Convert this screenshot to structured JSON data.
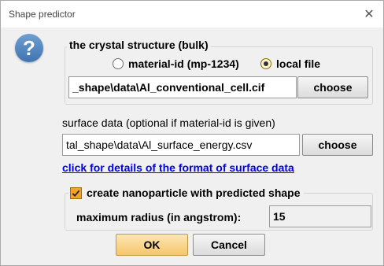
{
  "window": {
    "title": "Shape predictor",
    "close_glyph": "✕"
  },
  "icons": {
    "question": "?"
  },
  "crystal": {
    "legend": "the crystal structure (bulk)",
    "option_material": "material-id (mp-1234)",
    "option_local": "local file",
    "selected": "local file",
    "file_value": "_shape\\data\\Al_conventional_cell.cif",
    "choose_label": "choose"
  },
  "surface": {
    "label": "surface data (optional if material-id is given)",
    "file_value": "tal_shape\\data\\Al_surface_energy.csv",
    "choose_label": "choose",
    "link_text": "click for details of the format of surface data"
  },
  "nanoparticle": {
    "checkbox_label": "create nanoparticle with predicted shape",
    "checked": true,
    "radius_label": "maximum radius (in angstrom):",
    "radius_value": "15"
  },
  "footer": {
    "ok_label": "OK",
    "cancel_label": "Cancel"
  },
  "colors": {
    "accent": "#f3a329",
    "link": "#0000ee",
    "icon_blue": "#3f74b0"
  }
}
